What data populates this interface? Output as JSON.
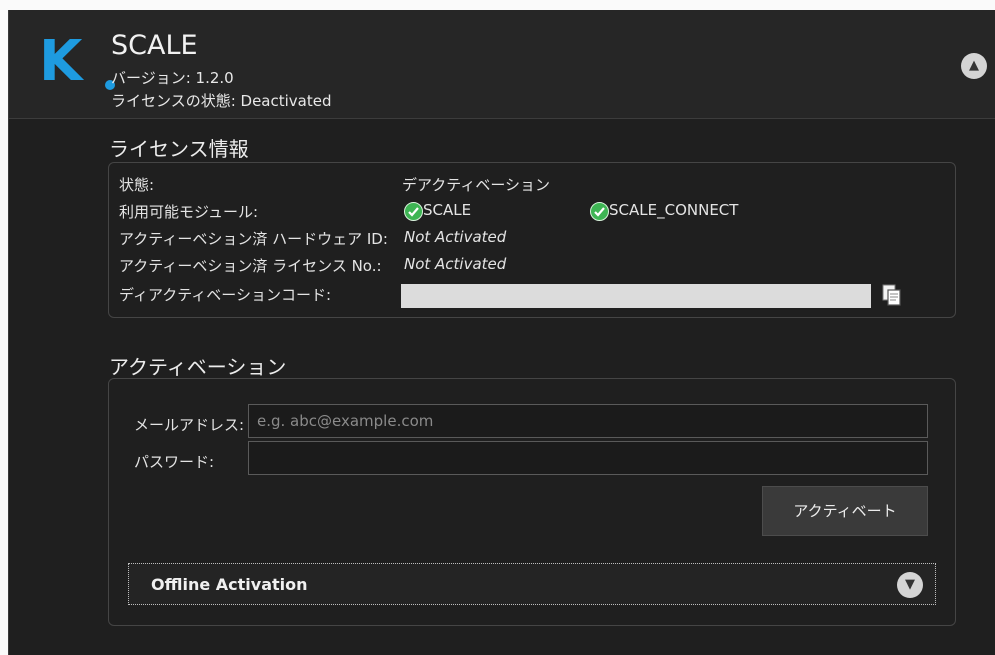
{
  "app": {
    "logo_text": "K",
    "title": "SCALE",
    "version_line": "バージョン: 1.2.0",
    "license_state_line": "ライセンスの状態: Deactivated"
  },
  "license_info": {
    "section_title": "ライセンス情報",
    "status_label": "状態:",
    "status_value": "デアクティベーション",
    "modules_label": "利用可能モジュール:",
    "modules": [
      "SCALE",
      "SCALE_CONNECT"
    ],
    "hw_id_label": "アクティーベション済 ハードウェア ID:",
    "hw_id_value": "Not Activated",
    "license_no_label": "アクティーベション済 ライセンス No.:",
    "license_no_value": "Not Activated",
    "deactivation_code_label": "ディアクティベーションコード:"
  },
  "activation": {
    "section_title": "アクティベーション",
    "email_label": "メールアドレス:",
    "email_placeholder": "e.g. abc@example.com",
    "email_value": "",
    "password_label": "パスワード:",
    "password_value": "",
    "activate_button": "アクティベート",
    "offline_label": "Offline Activation"
  },
  "colors": {
    "accent": "#1e9be0",
    "check": "#3eb554",
    "panel_bg": "#1f1f1f"
  },
  "icons": {
    "collapse": "chevron-up-icon",
    "expand": "chevron-down-icon",
    "copy": "copy-icon",
    "check": "check-circle-icon"
  }
}
